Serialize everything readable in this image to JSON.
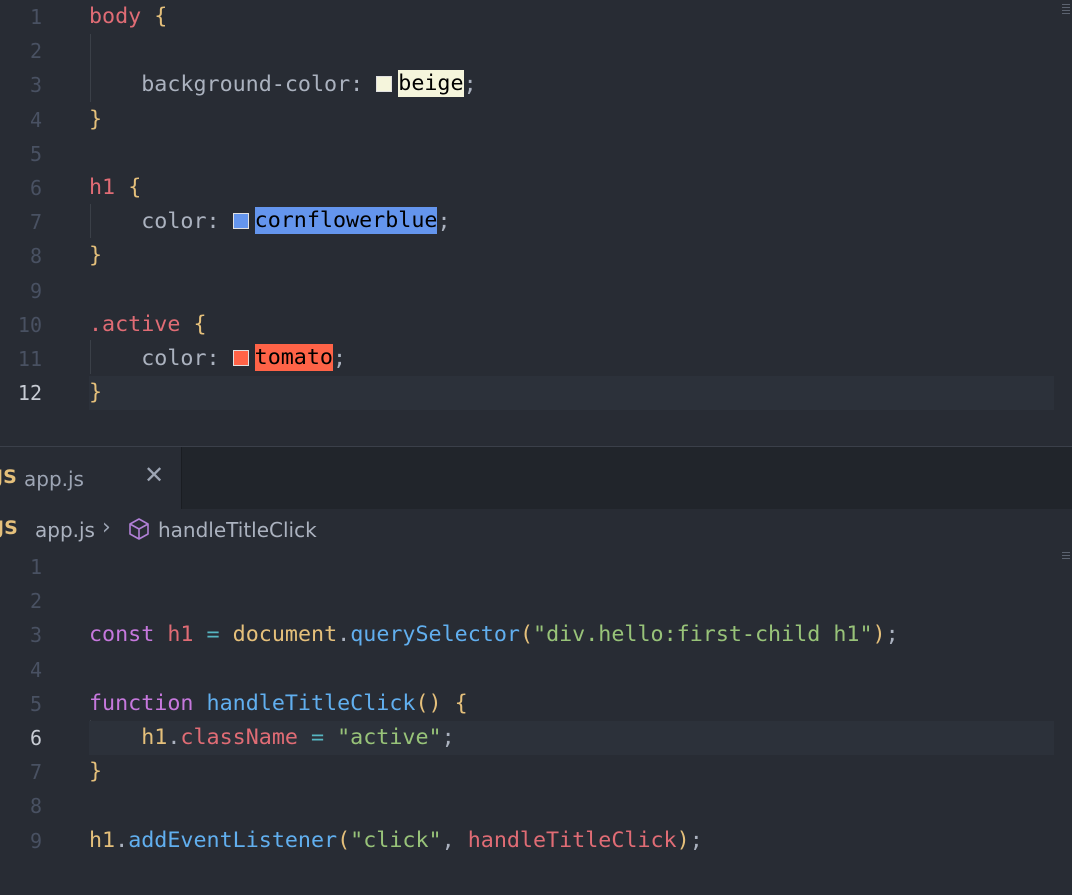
{
  "css_editor": {
    "lines": [
      {
        "n": "1",
        "tokens": [
          {
            "t": "body",
            "c": "sel"
          },
          {
            "t": " "
          },
          {
            "t": "{",
            "c": "brace"
          }
        ]
      },
      {
        "n": "2",
        "tokens": []
      },
      {
        "n": "3",
        "tokens": [
          {
            "t": "    background-color: ",
            "c": "prop"
          },
          {
            "swatch": "#f5f5dc"
          },
          {
            "t": "beige",
            "c": "colorval",
            "bg": "#f5f5dc",
            "fg": "#000000"
          },
          {
            "t": ";",
            "c": "punc"
          }
        ]
      },
      {
        "n": "4",
        "tokens": [
          {
            "t": "}",
            "c": "brace"
          }
        ]
      },
      {
        "n": "5",
        "tokens": []
      },
      {
        "n": "6",
        "tokens": [
          {
            "t": "h1",
            "c": "sel"
          },
          {
            "t": " "
          },
          {
            "t": "{",
            "c": "brace"
          }
        ]
      },
      {
        "n": "7",
        "tokens": [
          {
            "t": "    color: ",
            "c": "prop"
          },
          {
            "swatch": "#6495ed"
          },
          {
            "t": "cornflowerblue",
            "c": "colorval",
            "bg": "#6495ed",
            "fg": "#000000"
          },
          {
            "t": ";",
            "c": "punc"
          }
        ]
      },
      {
        "n": "8",
        "tokens": [
          {
            "t": "}",
            "c": "brace"
          }
        ]
      },
      {
        "n": "9",
        "tokens": []
      },
      {
        "n": "10",
        "tokens": [
          {
            "t": ".active",
            "c": "sel"
          },
          {
            "t": " "
          },
          {
            "t": "{",
            "c": "brace"
          }
        ]
      },
      {
        "n": "11",
        "tokens": [
          {
            "t": "    color: ",
            "c": "prop"
          },
          {
            "swatch": "#ff6347"
          },
          {
            "t": "tomato",
            "c": "colorval",
            "bg": "#ff6347",
            "fg": "#000000"
          },
          {
            "t": ";",
            "c": "punc"
          }
        ]
      },
      {
        "n": "12",
        "tokens": [
          {
            "t": "}",
            "c": "brace"
          }
        ]
      }
    ],
    "active_line": "12"
  },
  "tab": {
    "icon": "JS",
    "label": "app.js",
    "close": "✕"
  },
  "breadcrumb": {
    "icon": "JS",
    "file": "app.js",
    "separator": "›",
    "symbol_icon": "cube-icon",
    "symbol": "handleTitleClick"
  },
  "js_editor": {
    "lines": [
      {
        "n": "1",
        "tokens": []
      },
      {
        "n": "2",
        "tokens": []
      },
      {
        "n": "3",
        "tokens": [
          {
            "t": "const",
            "c": "kw"
          },
          {
            "t": " "
          },
          {
            "t": "h1",
            "c": "var"
          },
          {
            "t": " "
          },
          {
            "t": "=",
            "c": "op"
          },
          {
            "t": " "
          },
          {
            "t": "document",
            "c": "obj"
          },
          {
            "t": ".",
            "c": "dot"
          },
          {
            "t": "querySelector",
            "c": "fn"
          },
          {
            "t": "(",
            "c": "paren"
          },
          {
            "t": "\"div.hello:first-child h1\"",
            "c": "str"
          },
          {
            "t": ")",
            "c": "paren"
          },
          {
            "t": ";",
            "c": "punc"
          }
        ]
      },
      {
        "n": "4",
        "tokens": []
      },
      {
        "n": "5",
        "tokens": [
          {
            "t": "function",
            "c": "kw"
          },
          {
            "t": " "
          },
          {
            "t": "handleTitleClick",
            "c": "fn"
          },
          {
            "t": "()",
            "c": "paren"
          },
          {
            "t": " "
          },
          {
            "t": "{",
            "c": "brace"
          }
        ]
      },
      {
        "n": "6",
        "tokens": [
          {
            "t": "    "
          },
          {
            "t": "h1",
            "c": "obj"
          },
          {
            "t": ".",
            "c": "dot"
          },
          {
            "t": "className",
            "c": "var"
          },
          {
            "t": " "
          },
          {
            "t": "=",
            "c": "op"
          },
          {
            "t": " "
          },
          {
            "t": "\"active\"",
            "c": "str"
          },
          {
            "t": ";",
            "c": "punc"
          }
        ]
      },
      {
        "n": "7",
        "tokens": [
          {
            "t": "}",
            "c": "brace"
          }
        ]
      },
      {
        "n": "8",
        "tokens": []
      },
      {
        "n": "9",
        "tokens": [
          {
            "t": "h1",
            "c": "obj"
          },
          {
            "t": ".",
            "c": "dot"
          },
          {
            "t": "addEventListener",
            "c": "fn"
          },
          {
            "t": "(",
            "c": "paren"
          },
          {
            "t": "\"click\"",
            "c": "str"
          },
          {
            "t": ", ",
            "c": "punc"
          },
          {
            "t": "handleTitleClick",
            "c": "var"
          },
          {
            "t": ")",
            "c": "paren"
          },
          {
            "t": ";",
            "c": "punc"
          }
        ]
      }
    ],
    "active_line": "6"
  }
}
